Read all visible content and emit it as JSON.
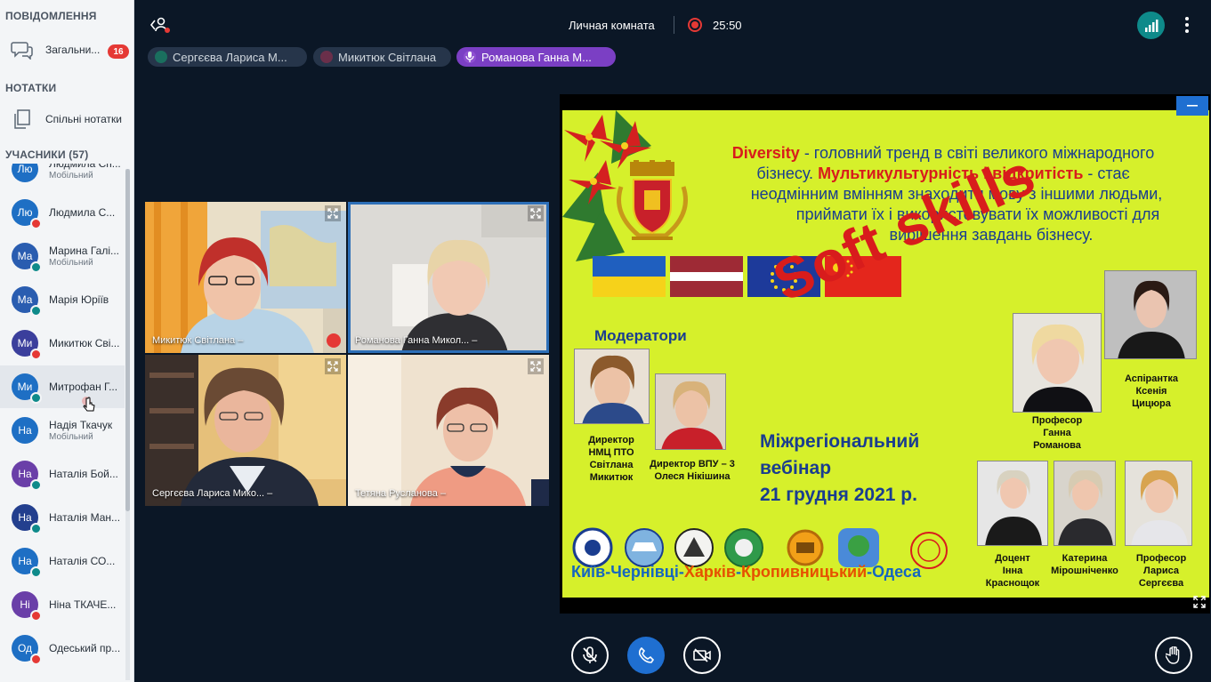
{
  "sidebar": {
    "messages_title": "ПОВІДОМЛЕННЯ",
    "general_chat": "Загальни...",
    "general_chat_badge": "16",
    "notes_title": "НОТАТКИ",
    "shared_notes": "Спільні нотатки",
    "participants_title": "УЧАСНИКИ (57)",
    "users": [
      {
        "initials": "Лю",
        "name": "Людмила Сп...",
        "role": "Мобільний",
        "color": "#1e6fc4",
        "status": "none"
      },
      {
        "initials": "Лю",
        "name": "Людмила С...",
        "role": "",
        "color": "#1e6fc4",
        "status": "muted"
      },
      {
        "initials": "Ма",
        "name": "Марина Галі...",
        "role": "Мобільний",
        "color": "#2a5db0",
        "status": "listen"
      },
      {
        "initials": "Ма",
        "name": "Марія Юріїв",
        "role": "",
        "color": "#2a5db0",
        "status": "listen"
      },
      {
        "initials": "Ми",
        "name": "Микитюк Сві...",
        "role": "",
        "color": "#3b3f9c",
        "status": "muted"
      },
      {
        "initials": "Ми",
        "name": "Митрофан Г...",
        "role": "",
        "color": "#1e6fc4",
        "status": "listen"
      },
      {
        "initials": "На",
        "name": "Надія Ткачук",
        "role": "Мобільний",
        "color": "#1e6fc4",
        "status": "none"
      },
      {
        "initials": "На",
        "name": "Наталія Бой...",
        "role": "",
        "color": "#6a3fa8",
        "status": "listen"
      },
      {
        "initials": "На",
        "name": "Наталія Ман...",
        "role": "",
        "color": "#233f8e",
        "status": "listen"
      },
      {
        "initials": "На",
        "name": "Наталія СО...",
        "role": "",
        "color": "#1e6fc4",
        "status": "listen"
      },
      {
        "initials": "Ні",
        "name": "Ніна ТКАЧЕ...",
        "role": "",
        "color": "#6a3fa8",
        "status": "muted"
      },
      {
        "initials": "Од",
        "name": "Одеський пр...",
        "role": "",
        "color": "#1e6fc4",
        "status": "muted"
      }
    ]
  },
  "topbar": {
    "room_title": "Личная комната",
    "recording_time": "25:50"
  },
  "speakers": [
    {
      "name": "Сергєєва Лариса М...",
      "dot": "#1a6f5e",
      "bg": "#26354a",
      "active": false
    },
    {
      "name": "Микитюк Світлана",
      "dot": "#6a2f4a",
      "bg": "#26354a",
      "active": false
    },
    {
      "name": "Романова Ганна М...",
      "dot": "#8e4fd1",
      "bg": "#7b3fc4",
      "active": true
    }
  ],
  "videos": [
    {
      "name": "Микитюк Світлана",
      "muted": true
    },
    {
      "name": "Романова Ганна Микол...",
      "muted": false
    },
    {
      "name": "Сергєєва Лариса Мико...",
      "muted": false
    },
    {
      "name": "Тетяна Русланова",
      "muted": false
    }
  ],
  "slide": {
    "intro_word1": "Diversity",
    "intro_rest1": " - головний тренд в світі великого міжнародного",
    "intro_line2a": "бізнесу. ",
    "intro_word2": "Мультикультурність і відкритість",
    "intro_line2b": " - стає",
    "intro_line3": "неодмінним вмінням знаходити мову з іншими людьми,",
    "intro_line4": "приймати їх і використовувати їх можливості для",
    "intro_line5": "вирішення завдань бізнесу.",
    "moderators_title": "Модератори",
    "soft_skills": "Soft skills",
    "event_line1": "Міжрегіональний",
    "event_line2": "вебінар",
    "event_date": "21 грудня 2021 р.",
    "cap_mod1": [
      "Директор",
      "НМЦ ПТО",
      "Світлана",
      "Микитюк"
    ],
    "cap_mod2": [
      "Директор ВПУ – 3",
      "Олеся Нікішина"
    ],
    "cap_romanova": [
      "Професор",
      "Ганна",
      "Романова"
    ],
    "cap_tsytsiura": [
      "Аспірантка",
      "Ксенія",
      "Цицюра"
    ],
    "cap_krasnoshchok": [
      "Доцент",
      "Інна",
      "Краснощок"
    ],
    "cap_miroshnichenko": [
      "Катерина",
      "Мірошніченко"
    ],
    "cap_sergeeva": [
      "Професор",
      "Лариса",
      "Сергєєва"
    ],
    "cities": [
      {
        "text": "Київ",
        "color": "#1565c0"
      },
      {
        "text": "-",
        "color": "#1565c0"
      },
      {
        "text": "Чернівці",
        "color": "#1565c0"
      },
      {
        "text": "-",
        "color": "#1565c0"
      },
      {
        "text": "Харків",
        "color": "#e65100"
      },
      {
        "text": "-",
        "color": "#1565c0"
      },
      {
        "text": "Кропивницький",
        "color": "#e65100"
      },
      {
        "text": "-",
        "color": "#1565c0"
      },
      {
        "text": "Одеса",
        "color": "#1565c0"
      }
    ]
  },
  "colors": {
    "accent": "#1f6fd1",
    "slide_bg": "#d6f02b",
    "slide_red": "#d81c1c",
    "slide_blue": "#1a3d8f"
  }
}
